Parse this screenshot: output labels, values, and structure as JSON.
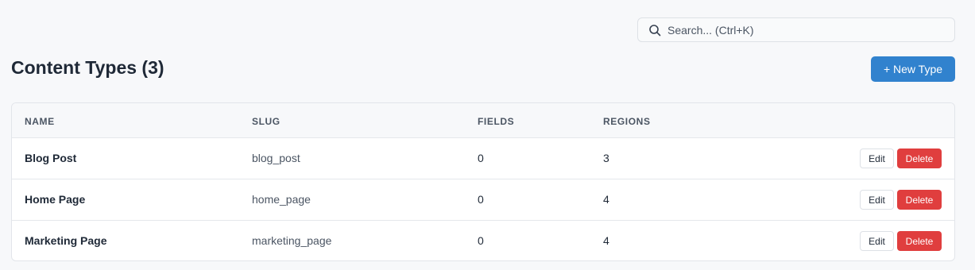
{
  "search": {
    "placeholder": "Search... (Ctrl+K)",
    "icon": "search-icon"
  },
  "page": {
    "title": "Content Types (3)",
    "new_button_label": "+ New Type"
  },
  "table": {
    "columns": [
      "NAME",
      "SLUG",
      "FIELDS",
      "REGIONS"
    ],
    "rows": [
      {
        "name": "Blog Post",
        "slug": "blog_post",
        "fields": "0",
        "regions": "3"
      },
      {
        "name": "Home Page",
        "slug": "home_page",
        "fields": "0",
        "regions": "4"
      },
      {
        "name": "Marketing Page",
        "slug": "marketing_page",
        "fields": "0",
        "regions": "4"
      }
    ],
    "edit_label": "Edit",
    "delete_label": "Delete"
  },
  "colors": {
    "primary": "#3182ce",
    "danger": "#e03e3e",
    "background": "#f7f8fa"
  }
}
